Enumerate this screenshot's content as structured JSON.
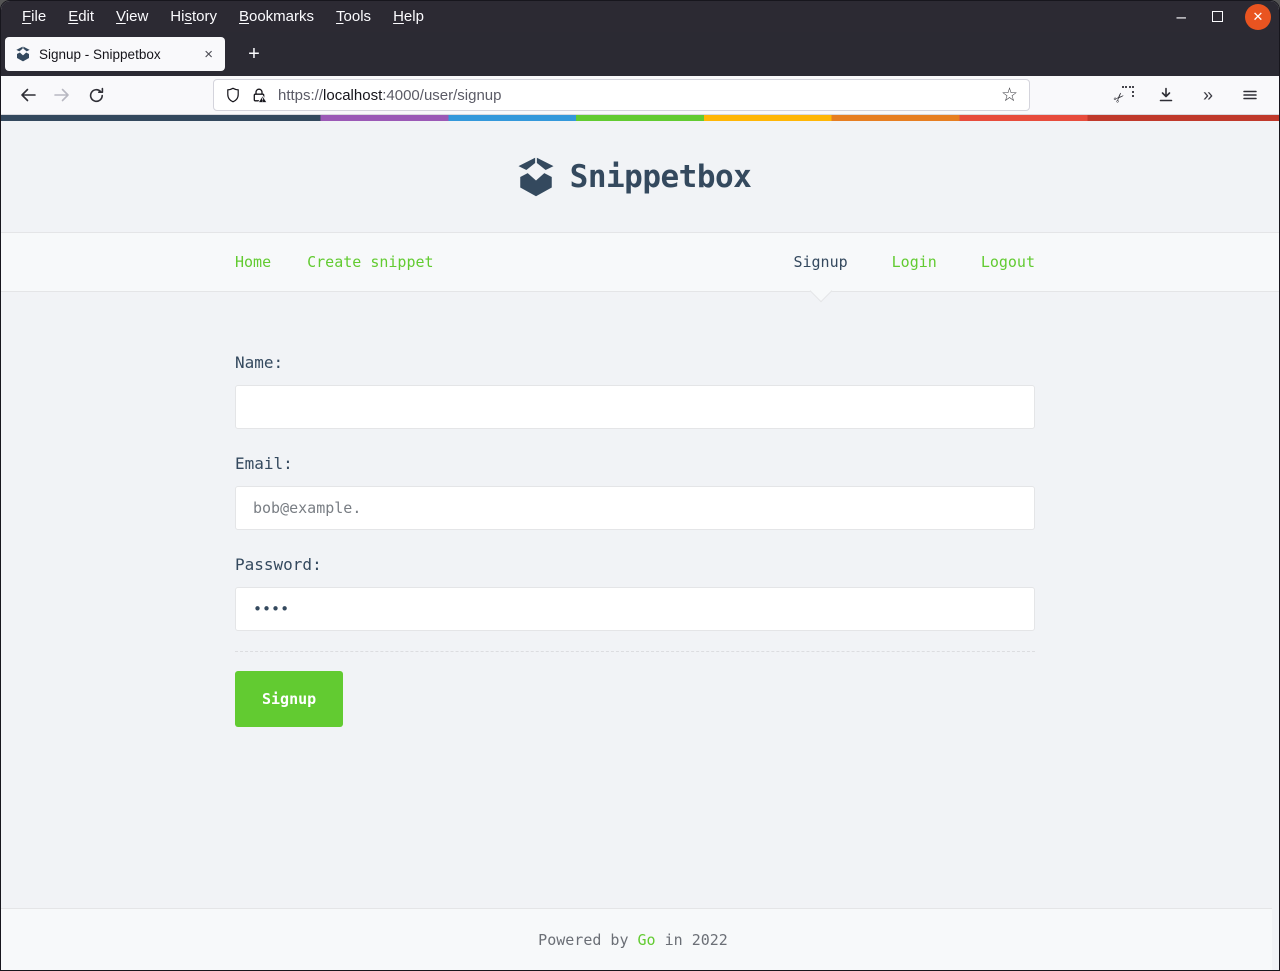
{
  "chrome": {
    "menu": {
      "items": [
        {
          "pre": "",
          "accel": "F",
          "post": "ile"
        },
        {
          "pre": "",
          "accel": "E",
          "post": "dit"
        },
        {
          "pre": "",
          "accel": "V",
          "post": "iew"
        },
        {
          "pre": "Hi",
          "accel": "s",
          "post": "tory"
        },
        {
          "pre": "",
          "accel": "B",
          "post": "ookmarks"
        },
        {
          "pre": "",
          "accel": "T",
          "post": "ools"
        },
        {
          "pre": "",
          "accel": "H",
          "post": "elp"
        }
      ]
    },
    "window_controls": {
      "minimize_glyph": "–",
      "close_glyph": "✕"
    },
    "tab": {
      "title": "Signup - Snippetbox",
      "close_glyph": "×"
    },
    "new_tab_glyph": "+",
    "urlbar": {
      "scheme": "https://",
      "host": "localhost",
      "path": ":4000/user/signup"
    },
    "overflow_glyph": "»"
  },
  "page": {
    "brand": "Snippetbox",
    "nav": {
      "left": [
        {
          "label": "Home"
        },
        {
          "label": "Create snippet"
        }
      ],
      "right": [
        {
          "label": "Signup"
        },
        {
          "label": "Login"
        },
        {
          "label": "Logout"
        }
      ]
    },
    "form": {
      "name_label": "Name:",
      "name_value": "",
      "email_label": "Email:",
      "email_value": "bob@example.",
      "password_label": "Password:",
      "password_value": "••••",
      "submit_label": "Signup"
    },
    "footer": {
      "pre": "Powered by ",
      "link": "Go",
      "post": " in 2022"
    }
  },
  "colors": {
    "accent_green": "#62CB31",
    "brand_dark": "#34495E",
    "nav_bg": "#F7F9FA",
    "page_bg": "#F1F3F6",
    "border": "#E4E5E7",
    "close_button_orange": "#E95420",
    "stripe": [
      "#34495E",
      "#9B59B6",
      "#3498DB",
      "#62CB31",
      "#FFB606",
      "#E67E22",
      "#E74C3C",
      "#C0392B"
    ]
  }
}
